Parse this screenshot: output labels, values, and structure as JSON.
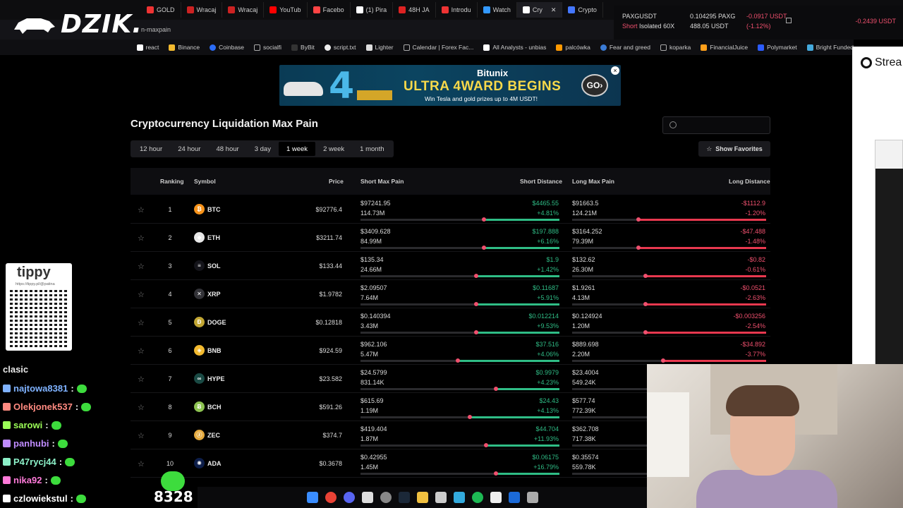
{
  "browser": {
    "tabs": [
      "GOLD",
      "Wracaj",
      "Wracaj",
      "YouTub",
      "Facebo",
      "(1) Pira",
      "48H JA",
      "Introdu",
      "Watch",
      "Cry",
      "Crypto"
    ],
    "url": "n-maxpain",
    "bookmarks": [
      "react",
      "Binance",
      "Coinbase",
      "socialfi",
      "ByBit",
      "script.txt",
      "Lighter",
      "Calendar | Forex Fac...",
      "All Analysts - unbias",
      "palcówka",
      "Fear and greed",
      "koparka",
      "FinancialJuice",
      "Polymarket",
      "Bright Funded"
    ]
  },
  "logo": {
    "text": "DZIK."
  },
  "trading": {
    "symbol": "PAXGUSDT",
    "side": "Short",
    "mode": "Isolated",
    "leverage": "60X",
    "qty": "0.104295 PAXG",
    "value": "488.05 USDT",
    "pnl": "-0.0917 USDT",
    "pnl_pct": "(-1.12%)",
    "right_value": "-0.2439 USDT"
  },
  "sidepanel": {
    "label": "Strea"
  },
  "banner": {
    "brand": "Bitunix",
    "headline": "ULTRA 4WARD BEGINS",
    "sub": "Win Tesla and gold prizes up to 4M USDT!",
    "go": "GO",
    "close": "×"
  },
  "page": {
    "title": "Cryptocurrency Liquidation Max Pain",
    "periods": [
      "12 hour",
      "24 hour",
      "48 hour",
      "3 day",
      "1 week",
      "2 week",
      "1 month"
    ],
    "active_period": "1 week",
    "favorites_button": "Show Favorites"
  },
  "table": {
    "headers": {
      "ranking": "Ranking",
      "symbol": "Symbol",
      "price": "Price",
      "short_max_pain": "Short Max Pain",
      "short_distance": "Short Distance",
      "long_max_pain": "Long Max Pain",
      "long_distance": "Long Distance"
    },
    "rows": [
      {
        "rank": "1",
        "symbol": "BTC",
        "icon": "btc-icon",
        "color": "#f7931a",
        "glyph": "₿",
        "price": "$92776.4",
        "smp": "$97241.95",
        "smv": "114.73M",
        "sd": "$4465.55",
        "sdp": "+4.81%",
        "lmp": "$91663.5",
        "lmv": "124.21M",
        "ld": "-$1112.9",
        "ldp": "-1.20%",
        "s_fill": 0.62,
        "l_fill": 0.34
      },
      {
        "rank": "2",
        "symbol": "ETH",
        "icon": "eth-icon",
        "color": "#e8e8e8",
        "glyph": "◆",
        "price": "$3211.74",
        "smp": "$3409.628",
        "smv": "84.99M",
        "sd": "$197.888",
        "sdp": "+6.16%",
        "lmp": "$3164.252",
        "lmv": "79.39M",
        "ld": "-$47.488",
        "ldp": "-1.48%",
        "s_fill": 0.62,
        "l_fill": 0.34
      },
      {
        "rank": "3",
        "symbol": "SOL",
        "icon": "sol-icon",
        "color": "#14141a",
        "glyph": "≡",
        "price": "$133.44",
        "smp": "$135.34",
        "smv": "24.66M",
        "sd": "$1.9",
        "sdp": "+1.42%",
        "lmp": "$132.62",
        "lmv": "26.30M",
        "ld": "-$0.82",
        "ldp": "-0.61%",
        "s_fill": 0.58,
        "l_fill": 0.38
      },
      {
        "rank": "4",
        "symbol": "XRP",
        "icon": "xrp-icon",
        "color": "#333338",
        "glyph": "✕",
        "price": "$1.9782",
        "smp": "$2.09507",
        "smv": "7.64M",
        "sd": "$0.11687",
        "sdp": "+5.91%",
        "lmp": "$1.9261",
        "lmv": "4.13M",
        "ld": "-$0.0521",
        "ldp": "-2.63%",
        "s_fill": 0.58,
        "l_fill": 0.38
      },
      {
        "rank": "5",
        "symbol": "DOGE",
        "icon": "doge-icon",
        "color": "#c2a633",
        "glyph": "Ð",
        "price": "$0.12818",
        "smp": "$0.140394",
        "smv": "3.43M",
        "sd": "$0.012214",
        "sdp": "+9.53%",
        "lmp": "$0.124924",
        "lmv": "1.20M",
        "ld": "-$0.003256",
        "ldp": "-2.54%",
        "s_fill": 0.58,
        "l_fill": 0.38
      },
      {
        "rank": "6",
        "symbol": "BNB",
        "icon": "bnb-icon",
        "color": "#f3ba2f",
        "glyph": "◈",
        "price": "$924.59",
        "smp": "$962.106",
        "smv": "5.47M",
        "sd": "$37.516",
        "sdp": "+4.06%",
        "lmp": "$889.698",
        "lmv": "2.20M",
        "ld": "-$34.892",
        "ldp": "-3.77%",
        "s_fill": 0.49,
        "l_fill": 0.47
      },
      {
        "rank": "7",
        "symbol": "HYPE",
        "icon": "hype-icon",
        "color": "#1a4a44",
        "glyph": "∞",
        "price": "$23.582",
        "smp": "$24.5799",
        "smv": "831.14K",
        "sd": "$0.9979",
        "sdp": "+4.23%",
        "lmp": "$23.4004",
        "lmv": "549.24K",
        "ld": "",
        "ldp": "",
        "s_fill": 0.68,
        "l_fill": 0.5
      },
      {
        "rank": "8",
        "symbol": "BCH",
        "icon": "bch-icon",
        "color": "#8dc351",
        "glyph": "Ƀ",
        "price": "$591.26",
        "smp": "$615.69",
        "smv": "1.19M",
        "sd": "$24.43",
        "sdp": "+4.13%",
        "lmp": "$577.74",
        "lmv": "772.39K",
        "ld": "",
        "ldp": "",
        "s_fill": 0.55,
        "l_fill": 0.5
      },
      {
        "rank": "9",
        "symbol": "ZEC",
        "icon": "zec-icon",
        "color": "#e5a93d",
        "glyph": "ⓩ",
        "price": "$374.7",
        "smp": "$419.404",
        "smv": "1.87M",
        "sd": "$44.704",
        "sdp": "+11.93%",
        "lmp": "$362.708",
        "lmv": "717.38K",
        "ld": "",
        "ldp": "",
        "s_fill": 0.63,
        "l_fill": 0.5
      },
      {
        "rank": "10",
        "symbol": "ADA",
        "icon": "ada-icon",
        "color": "#0d1e4a",
        "glyph": "✺",
        "price": "$0.3678",
        "smp": "$0.42955",
        "smv": "1.45M",
        "sd": "$0.06175",
        "sdp": "+16.79%",
        "lmp": "$0.35574",
        "lmv": "559.78K",
        "ld": "",
        "ldp": "",
        "s_fill": 0.68,
        "l_fill": 0.5
      }
    ]
  },
  "overlay": {
    "tippy_name": "tippy",
    "tippy_url": "https://tippy.pl/@patina",
    "chat_title": "clasic",
    "chat": [
      {
        "user": "najtowa8381",
        "color": "#7fb2ff"
      },
      {
        "user": "Olekjonek537",
        "color": "#ff8a80"
      },
      {
        "user": "sarowi",
        "color": "#9cff57"
      },
      {
        "user": "panhubi",
        "color": "#c08cff"
      },
      {
        "user": "P47rycj44",
        "color": "#8cf0c8"
      },
      {
        "user": "nika92",
        "color": "#ff7ad9"
      },
      {
        "user": "czlowiekstul",
        "color": "#ffffff"
      }
    ],
    "counter": "8328"
  }
}
